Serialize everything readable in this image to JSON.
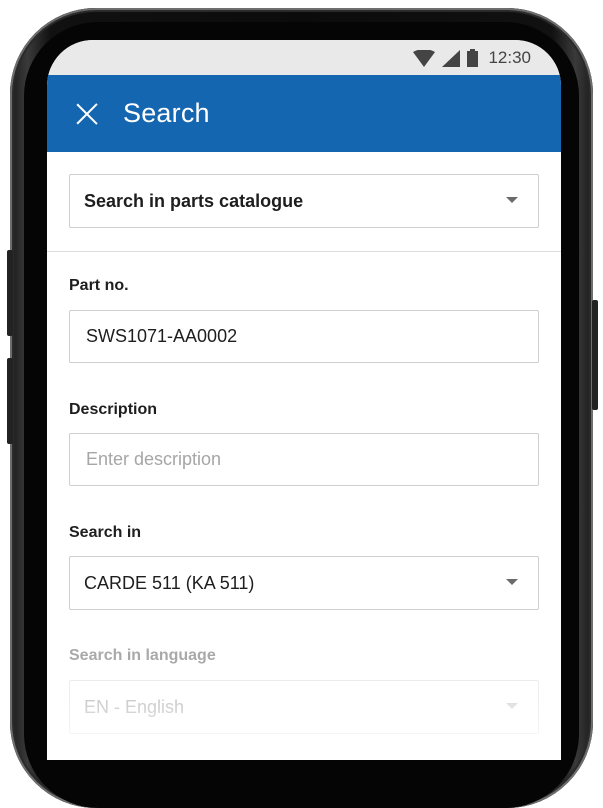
{
  "status_bar": {
    "time": "12:30",
    "icons": [
      "wifi-icon",
      "signal-icon",
      "battery-icon"
    ]
  },
  "app_bar": {
    "title": "Search",
    "close_icon": "close-icon",
    "color": "#1566b1"
  },
  "catalogue_select": {
    "value": "Search in parts catalogue"
  },
  "form": {
    "part_no": {
      "label": "Part no.",
      "value": "SWS1071-AA0002"
    },
    "description": {
      "label": "Description",
      "placeholder": "Enter description"
    },
    "search_in": {
      "label": "Search in",
      "value": "CARDE 511 (KA 511)"
    },
    "search_language": {
      "label": "Search in language",
      "value": "EN - English"
    }
  }
}
